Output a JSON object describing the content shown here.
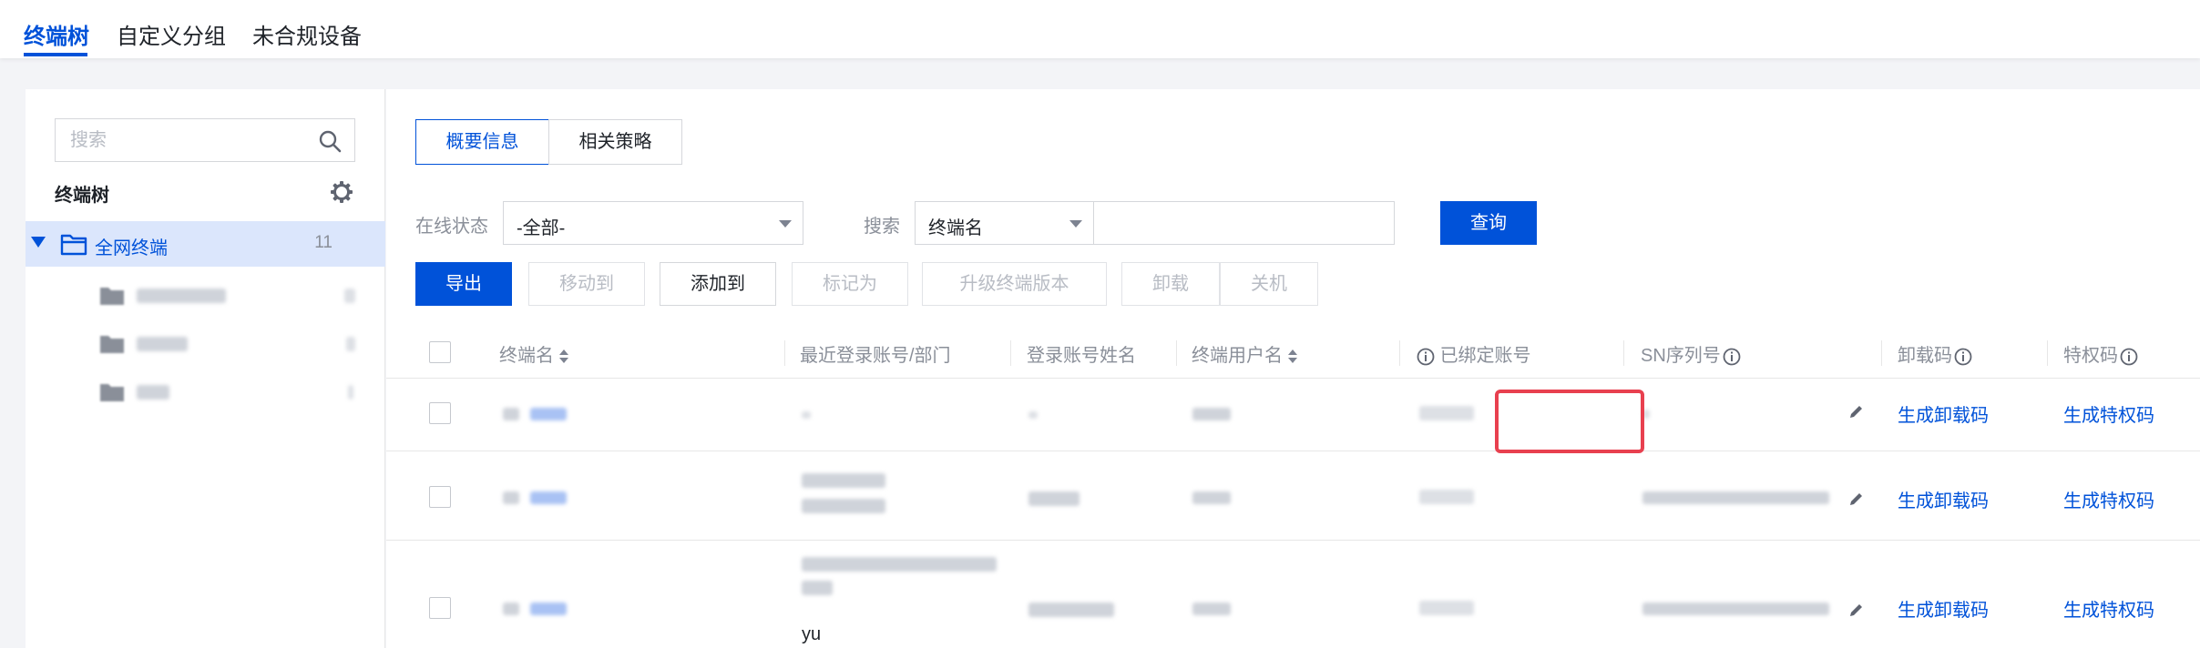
{
  "top_tabs": [
    "终端树",
    "自定义分组",
    "未合规设备"
  ],
  "sidebar": {
    "search_placeholder": "搜索",
    "tree_title": "终端树",
    "root": {
      "label": "全网终端",
      "count": "11"
    }
  },
  "main": {
    "segments": [
      "概要信息",
      "相关策略"
    ],
    "filters": {
      "status_label": "在线状态",
      "status_value": "-全部-",
      "search_label": "搜索",
      "search_field": "终端名",
      "query_button": "查询"
    },
    "actions": [
      "导出",
      "移动到",
      "添加到",
      "标记为",
      "升级终端版本",
      "卸载",
      "关机"
    ],
    "table": {
      "headers": [
        "终端名",
        "最近登录账号/部门",
        "登录账号姓名",
        "终端用户名",
        "已绑定账号",
        "SN序列号",
        "卸载码",
        "特权码"
      ],
      "rows": [
        {
          "uninstall": "生成卸载码",
          "privilege": "生成特权码"
        },
        {
          "uninstall": "生成卸载码",
          "privilege": "生成特权码"
        },
        {
          "uninstall": "生成卸载码",
          "privilege": "生成特权码",
          "extra_text": "yu"
        }
      ]
    }
  },
  "colors": {
    "accent": "#0052d9",
    "highlight": "#e8404f"
  }
}
